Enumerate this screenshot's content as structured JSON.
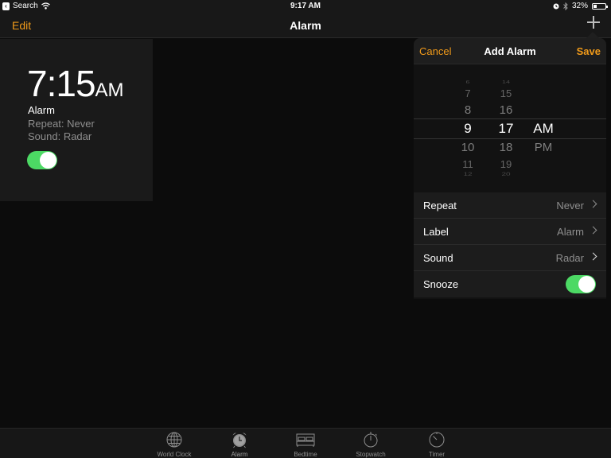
{
  "status_bar": {
    "back_app": "Search",
    "time": "9:17 AM",
    "battery_percent_text": "32%",
    "battery_level": 0.32,
    "icons": [
      "back-icon",
      "wifi-icon",
      "alarm-status-icon",
      "bluetooth-icon",
      "battery-icon"
    ]
  },
  "nav": {
    "edit_label": "Edit",
    "title": "Alarm",
    "add_icon": "plus-icon"
  },
  "alarms": [
    {
      "time": "7:15",
      "ampm": "AM",
      "label": "Alarm",
      "repeat": "Repeat: Never",
      "sound": "Sound: Radar",
      "enabled": true
    }
  ],
  "add_alarm": {
    "cancel_label": "Cancel",
    "title": "Add Alarm",
    "save_label": "Save",
    "picker": {
      "hours": [
        "6",
        "7",
        "8",
        "9",
        "10",
        "11",
        "12"
      ],
      "minutes": [
        "14",
        "15",
        "16",
        "17",
        "18",
        "19",
        "20"
      ],
      "periods": [
        "AM",
        "PM"
      ],
      "selected": {
        "hour": "9",
        "minute": "17",
        "period": "AM"
      }
    },
    "settings": [
      {
        "label": "Repeat",
        "value": "Never"
      },
      {
        "label": "Label",
        "value": "Alarm"
      },
      {
        "label": "Sound",
        "value": "Radar"
      },
      {
        "label": "Snooze",
        "toggle": true
      }
    ]
  },
  "tabs": [
    {
      "label": "World Clock",
      "icon": "globe-icon",
      "active": false
    },
    {
      "label": "Alarm",
      "icon": "alarm-clock-icon",
      "active": true
    },
    {
      "label": "Bedtime",
      "icon": "bed-icon",
      "active": false
    },
    {
      "label": "Stopwatch",
      "icon": "stopwatch-icon",
      "active": false
    },
    {
      "label": "Timer",
      "icon": "timer-icon",
      "active": false
    }
  ],
  "colors": {
    "accent": "#f09a1a",
    "toggle_on": "#4cd964",
    "background": "#0c0c0c"
  }
}
